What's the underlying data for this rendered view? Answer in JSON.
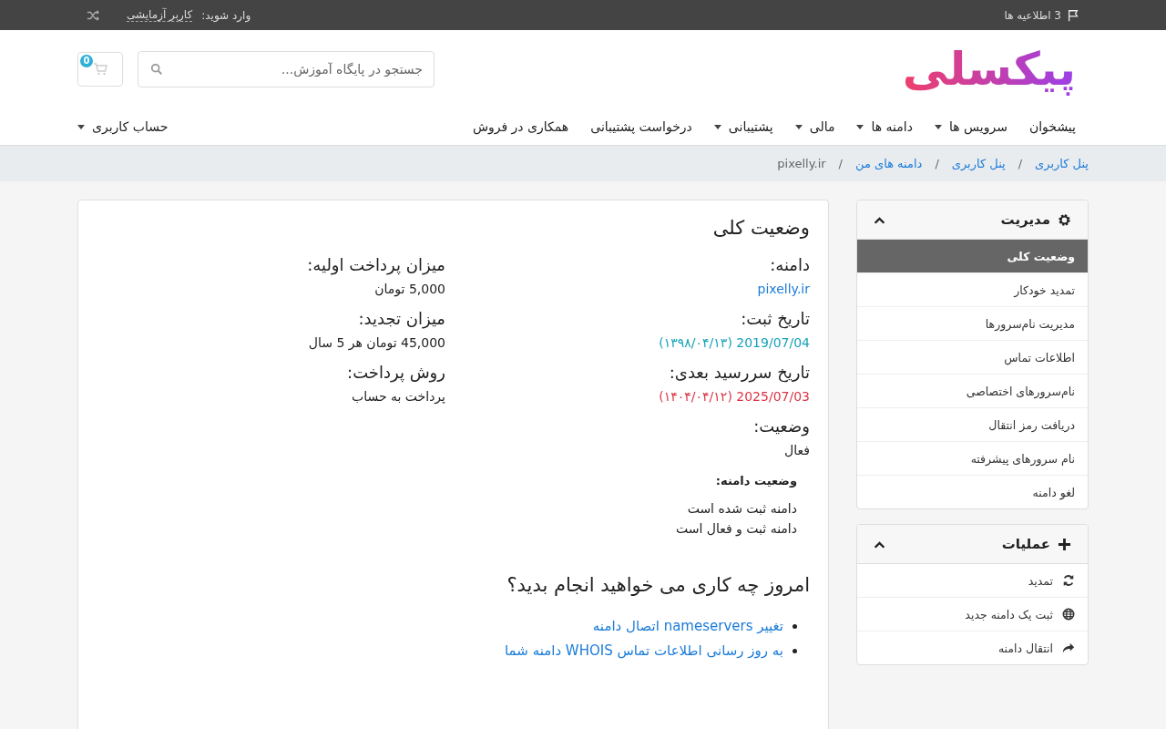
{
  "top_bar": {
    "notifications": "3 اطلاعیه ها",
    "login_label": "وارد شوید:",
    "user": "کاربر آزمایشی"
  },
  "header": {
    "logo": "پیکسلی",
    "search": {
      "placeholder": "جستجو در پایگاه آموزش..."
    },
    "cart_count": "0"
  },
  "nav": {
    "items": [
      {
        "label": "پیشخوان",
        "dropdown": false
      },
      {
        "label": "سرویس ها",
        "dropdown": true
      },
      {
        "label": "دامنه ها",
        "dropdown": true
      },
      {
        "label": "مالی",
        "dropdown": true
      },
      {
        "label": "پشتیبانی",
        "dropdown": true
      },
      {
        "label": "درخواست پشتیبانی",
        "dropdown": false
      },
      {
        "label": "همکاری در فروش",
        "dropdown": false
      }
    ],
    "account": {
      "label": "حساب کاربری",
      "dropdown": true
    }
  },
  "breadcrumb": [
    {
      "label": "پنل کاربری",
      "link": true
    },
    {
      "separator": "/",
      "label": "پنل کاربری",
      "link": true
    },
    {
      "separator": "/",
      "label": "دامنه های من",
      "link": true
    },
    {
      "separator": "/",
      "label": "pixelly.ir",
      "link": false
    }
  ],
  "sidebar": [
    {
      "title": "مدیریت",
      "kind": "gear",
      "expanded": true,
      "items": [
        {
          "label": "وضعیت کلی",
          "selected": true
        },
        {
          "label": "تمدید خودکار",
          "selected": false
        },
        {
          "label": "مدیریت نام‌سرورها",
          "selected": false
        },
        {
          "label": "اطلاعات تماس",
          "selected": false
        },
        {
          "label": "نام‌سرورهای اختصاصی",
          "selected": false
        },
        {
          "label": "دریافت رمز انتقال",
          "selected": false
        },
        {
          "label": "نام سرورهای پیشرفته",
          "selected": false
        },
        {
          "label": "لغو دامنه",
          "selected": false
        }
      ]
    },
    {
      "title": "عملیات",
      "kind": "plus",
      "expanded": true,
      "items": [
        {
          "label": "تمدید",
          "selected": false,
          "kind": "refresh"
        },
        {
          "label": "ثبت یک دامنه جدید",
          "selected": false,
          "kind": "globe"
        },
        {
          "label": "انتقال دامنه",
          "selected": false,
          "kind": "share"
        }
      ]
    }
  ],
  "content": {
    "title": "وضعیت کلی",
    "fields": [
      {
        "label": "دامنه:",
        "value": "pixelly.ir",
        "kind": "link"
      },
      {
        "label": "میزان پرداخت اولیه:",
        "value": "5,000 تومان",
        "kind": "plain"
      },
      {
        "label": "تاریخ ثبت:",
        "value": "2019/07/04 (۱۳۹۸/۰۴/۱۳)",
        "kind": "info"
      },
      {
        "label": "میزان تجدید:",
        "value": "45,000 تومان هر 5 سال",
        "kind": "plain"
      },
      {
        "label": "تاریخ سررسید بعدی:",
        "value": "2025/07/03 (۱۴۰۴/۰۴/۱۲)",
        "kind": "danger"
      },
      {
        "label": "روش پرداخت:",
        "value": "پرداخت به حساب",
        "kind": "plain"
      },
      {
        "label": "وضعیت:",
        "value": "فعال",
        "kind": "plain"
      }
    ],
    "domain_status": {
      "label": "وضعیت دامنه:",
      "lines": [
        "دامنه ثبت شده است",
        "دامنه ثبت و فعال است"
      ]
    },
    "actions": {
      "title": "امروز چه کاری می خواهید انجام بدید؟",
      "links": [
        "تغییر nameservers اتصال دامنه",
        "به روز رسانی اطلاعات تماس WHOIS دامنه شما"
      ]
    }
  }
}
